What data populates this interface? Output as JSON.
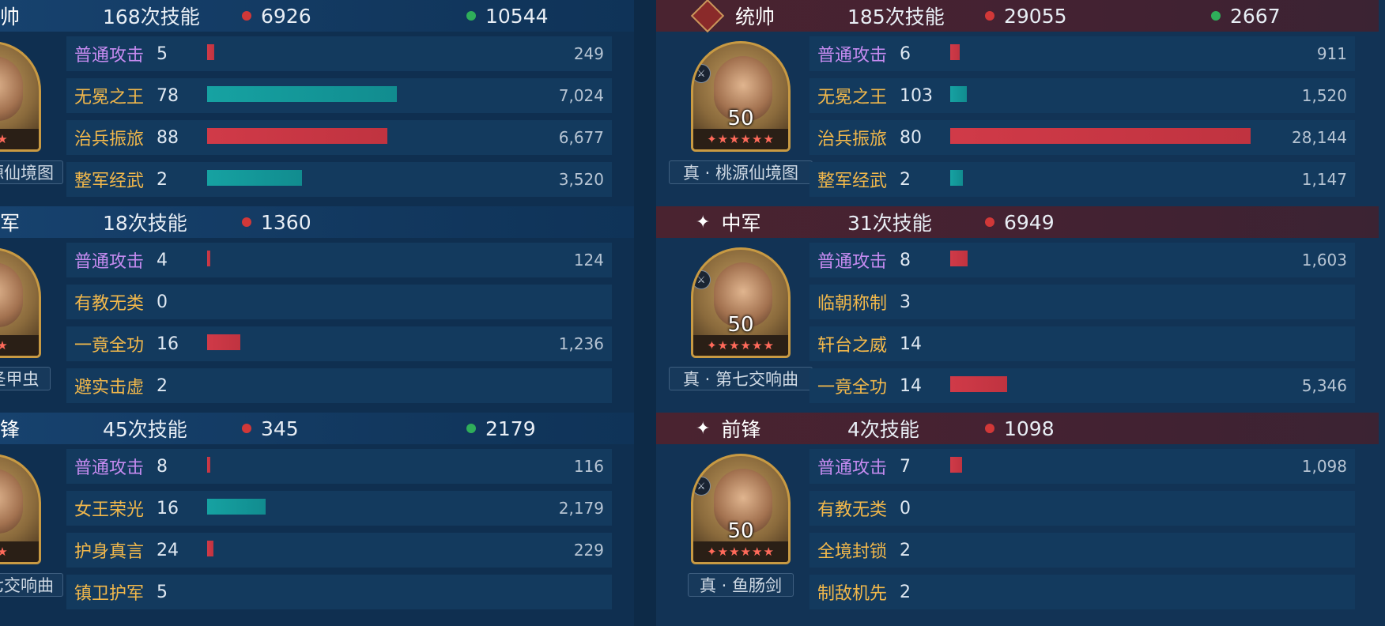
{
  "left": {
    "roles": [
      {
        "title": "帅",
        "casts": "168次技能",
        "red_value": "6926",
        "green_value": "10544",
        "level": "0",
        "stars": "★★★",
        "nameplate": "源仙境图",
        "skills": [
          {
            "name": "普通攻击",
            "color": "purple",
            "count": "5",
            "bar": "red",
            "fill": 0.018,
            "value": "249"
          },
          {
            "name": "无冕之王",
            "color": "gold",
            "count": "78",
            "bar": "teal",
            "fill": 0.5,
            "value": "7,024"
          },
          {
            "name": "治兵振旅",
            "color": "gold",
            "count": "88",
            "bar": "red",
            "fill": 0.474,
            "value": "6,677"
          },
          {
            "name": "整军经武",
            "color": "gold",
            "count": "2",
            "bar": "teal",
            "fill": 0.25,
            "value": "3,520"
          }
        ]
      },
      {
        "title": "军",
        "casts": "18次技能",
        "red_value": "1360",
        "green_value": "",
        "level": "0",
        "stars": "★★★",
        "nameplate": "圣甲虫",
        "skills": [
          {
            "name": "普通攻击",
            "color": "purple",
            "count": "4",
            "bar": "red",
            "fill": 0.009,
            "value": "124"
          },
          {
            "name": "有教无类",
            "color": "gold",
            "count": "0",
            "bar": "",
            "fill": 0,
            "value": ""
          },
          {
            "name": "一竟全功",
            "color": "gold",
            "count": "16",
            "bar": "red",
            "fill": 0.088,
            "value": "1,236"
          },
          {
            "name": "避实击虚",
            "color": "gold",
            "count": "2",
            "bar": "",
            "fill": 0,
            "value": ""
          }
        ]
      },
      {
        "title": "锋",
        "casts": "45次技能",
        "red_value": "345",
        "green_value": "2179",
        "level": "0",
        "stars": "★★★",
        "nameplate": "七交响曲",
        "skills": [
          {
            "name": "普通攻击",
            "color": "purple",
            "count": "8",
            "bar": "red",
            "fill": 0.008,
            "value": "116"
          },
          {
            "name": "女王荣光",
            "color": "gold",
            "count": "16",
            "bar": "teal",
            "fill": 0.155,
            "value": "2,179"
          },
          {
            "name": "护身真言",
            "color": "gold",
            "count": "24",
            "bar": "red",
            "fill": 0.016,
            "value": "229"
          },
          {
            "name": "镇卫护军",
            "color": "gold",
            "count": "5",
            "bar": "",
            "fill": 0,
            "value": ""
          }
        ]
      }
    ]
  },
  "right": {
    "roles": [
      {
        "icon": "sword-icon",
        "title": "统帅",
        "casts": "185次技能",
        "red_value": "29055",
        "green_value": "2667",
        "level": "50",
        "stars": "✦★★★★★",
        "nameplate": "真 · 桃源仙境图",
        "skills": [
          {
            "name": "普通攻击",
            "color": "purple",
            "count": "6",
            "bar": "red",
            "fill": 0.032,
            "value": "911"
          },
          {
            "name": "无冕之王",
            "color": "gold",
            "count": "103",
            "bar": "teal",
            "fill": 0.054,
            "value": "1,520"
          },
          {
            "name": "治兵振旅",
            "color": "gold",
            "count": "80",
            "bar": "red",
            "fill": 1.0,
            "value": "28,144"
          },
          {
            "name": "整军经武",
            "color": "gold",
            "count": "2",
            "bar": "teal",
            "fill": 0.041,
            "value": "1,147"
          }
        ]
      },
      {
        "icon": "sparkle-icon",
        "title": "中军",
        "casts": "31次技能",
        "red_value": "6949",
        "green_value": "",
        "level": "50",
        "stars": "✦★★★★★",
        "nameplate": "真 · 第七交响曲",
        "skills": [
          {
            "name": "普通攻击",
            "color": "purple",
            "count": "8",
            "bar": "red",
            "fill": 0.057,
            "value": "1,603"
          },
          {
            "name": "临朝称制",
            "color": "gold",
            "count": "3",
            "bar": "",
            "fill": 0,
            "value": ""
          },
          {
            "name": "轩台之威",
            "color": "gold",
            "count": "14",
            "bar": "",
            "fill": 0,
            "value": ""
          },
          {
            "name": "一竟全功",
            "color": "gold",
            "count": "14",
            "bar": "red",
            "fill": 0.19,
            "value": "5,346"
          }
        ]
      },
      {
        "icon": "sparkle-icon",
        "title": "前锋",
        "casts": "4次技能",
        "red_value": "1098",
        "green_value": "",
        "level": "50",
        "stars": "✦★★★★★",
        "nameplate": "真 · 鱼肠剑",
        "skills": [
          {
            "name": "普通攻击",
            "color": "purple",
            "count": "7",
            "bar": "red",
            "fill": 0.039,
            "value": "1,098"
          },
          {
            "name": "有教无类",
            "color": "gold",
            "count": "0",
            "bar": "",
            "fill": 0,
            "value": ""
          },
          {
            "name": "全境封锁",
            "color": "gold",
            "count": "2",
            "bar": "",
            "fill": 0,
            "value": ""
          },
          {
            "name": "制敌机先",
            "color": "gold",
            "count": "2",
            "bar": "",
            "fill": 0,
            "value": ""
          }
        ]
      }
    ]
  }
}
